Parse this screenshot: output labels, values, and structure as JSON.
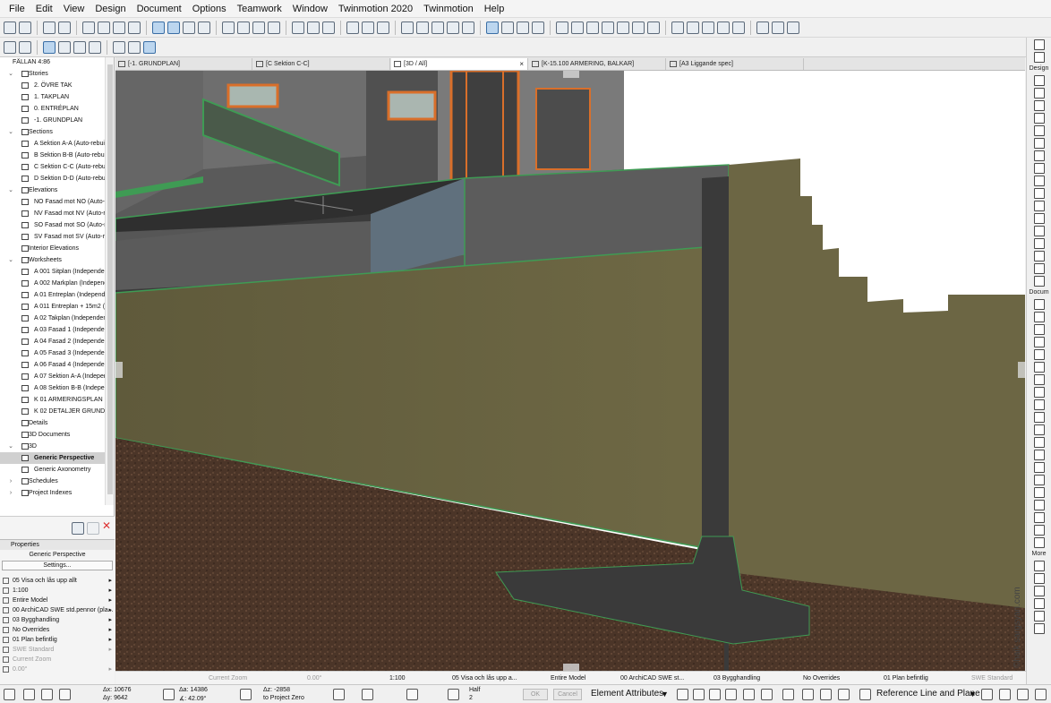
{
  "menu": [
    "File",
    "Edit",
    "View",
    "Design",
    "Document",
    "Options",
    "Teamwork",
    "Window",
    "Twinmotion 2020",
    "Twinmotion",
    "Help"
  ],
  "navigator": {
    "project": "FÄLLAN 4:86",
    "tree": [
      {
        "label": "Stories",
        "level": 1,
        "expander": "open",
        "icon": "stories-icon"
      },
      {
        "label": "2. ÖVRE TAK",
        "level": 2,
        "icon": "story-icon"
      },
      {
        "label": "1. TAKPLAN",
        "level": 2,
        "icon": "story-icon"
      },
      {
        "label": "0. ENTRÉPLAN",
        "level": 2,
        "icon": "story-icon"
      },
      {
        "label": "-1. GRUNDPLAN",
        "level": 2,
        "icon": "story-icon"
      },
      {
        "label": "Sections",
        "level": 1,
        "expander": "open",
        "icon": "sections-icon"
      },
      {
        "label": "A Sektion A-A (Auto-rebuil",
        "level": 2,
        "icon": "section-icon"
      },
      {
        "label": "B Sektion B-B (Auto-rebuil",
        "level": 2,
        "icon": "section-icon"
      },
      {
        "label": "C Sektion C-C (Auto-rebuil",
        "level": 2,
        "icon": "section-icon"
      },
      {
        "label": "D Sektion D-D (Auto-rebuil",
        "level": 2,
        "icon": "section-icon"
      },
      {
        "label": "Elevations",
        "level": 1,
        "expander": "open",
        "icon": "elevations-icon"
      },
      {
        "label": "NO Fasad mot NO (Auto-re",
        "level": 2,
        "icon": "elevation-icon"
      },
      {
        "label": "NV Fasad mot NV (Auto-re",
        "level": 2,
        "icon": "elevation-icon"
      },
      {
        "label": "SO Fasad mot SO (Auto-re",
        "level": 2,
        "icon": "elevation-icon"
      },
      {
        "label": "SV Fasad mot SV (Auto-rel",
        "level": 2,
        "icon": "elevation-icon"
      },
      {
        "label": "Interior Elevations",
        "level": 1,
        "icon": "interior-elevations-icon"
      },
      {
        "label": "Worksheets",
        "level": 1,
        "expander": "open",
        "icon": "worksheets-icon"
      },
      {
        "label": "A 001 Sitplan (Independen",
        "level": 2,
        "icon": "worksheet-icon"
      },
      {
        "label": "A 002 Markplan (Independ",
        "level": 2,
        "icon": "worksheet-icon"
      },
      {
        "label": "A 01 Entreplan (Independ",
        "level": 2,
        "icon": "worksheet-icon"
      },
      {
        "label": "A 011 Entreplan + 15m2 (I",
        "level": 2,
        "icon": "worksheet-icon"
      },
      {
        "label": "A 02 Takplan (Independen",
        "level": 2,
        "icon": "worksheet-icon"
      },
      {
        "label": "A 03 Fasad 1 (Independen",
        "level": 2,
        "icon": "worksheet-icon"
      },
      {
        "label": "A 04 Fasad 2 (Independen",
        "level": 2,
        "icon": "worksheet-icon"
      },
      {
        "label": "A 05 Fasad 3 (Independen",
        "level": 2,
        "icon": "worksheet-icon"
      },
      {
        "label": "A 06 Fasad 4 (Independen",
        "level": 2,
        "icon": "worksheet-icon"
      },
      {
        "label": "A 07 Sektion A-A (Indepen",
        "level": 2,
        "icon": "worksheet-icon"
      },
      {
        "label": "A 08 Sektion B-B (Independ",
        "level": 2,
        "icon": "worksheet-icon"
      },
      {
        "label": "K 01 ARMERINGSPLAN (Inc",
        "level": 2,
        "icon": "worksheet-icon"
      },
      {
        "label": "K 02 DETALJER GRUND (In",
        "level": 2,
        "icon": "worksheet-icon"
      },
      {
        "label": "Details",
        "level": 1,
        "icon": "details-icon"
      },
      {
        "label": "3D Documents",
        "level": 1,
        "icon": "3d-documents-icon"
      },
      {
        "label": "3D",
        "level": 1,
        "expander": "open",
        "icon": "3d-icon"
      },
      {
        "label": "Generic Perspective",
        "level": 2,
        "icon": "perspective-icon",
        "selected": true
      },
      {
        "label": "Generic Axonometry",
        "level": 2,
        "icon": "axonometry-icon"
      },
      {
        "label": "Schedules",
        "level": 1,
        "expander": "closed",
        "icon": "schedules-icon"
      },
      {
        "label": "Project Indexes",
        "level": 1,
        "expander": "closed",
        "icon": "project-indexes-icon"
      }
    ]
  },
  "properties": {
    "header": "Properties",
    "view_name": "Generic Perspective",
    "settings_label": "Settings...",
    "rows": [
      {
        "text": "05 Visa och lås upp allt",
        "arrow": true,
        "dim": false,
        "icon": "layers-icon"
      },
      {
        "text": "1:100",
        "arrow": true,
        "dim": false,
        "icon": "scale-icon"
      },
      {
        "text": "Entire Model",
        "arrow": true,
        "dim": false,
        "icon": "structure-icon"
      },
      {
        "text": "00 ArchiCAD SWE std.pennor (pla...",
        "arrow": true,
        "dim": false,
        "icon": "pen-set-icon"
      },
      {
        "text": "03 Bygghandling",
        "arrow": true,
        "dim": false,
        "icon": "model-view-icon"
      },
      {
        "text": "No Overrides",
        "arrow": true,
        "dim": false,
        "icon": "override-icon"
      },
      {
        "text": "01 Plan befintlig",
        "arrow": true,
        "dim": false,
        "icon": "renovation-icon"
      },
      {
        "text": "SWE Standard",
        "arrow": true,
        "dim": true,
        "icon": "dimension-icon"
      },
      {
        "text": "Current Zoom",
        "arrow": false,
        "dim": true,
        "icon": "zoom-icon"
      },
      {
        "text": "0.00°",
        "arrow": true,
        "dim": true,
        "icon": "rotation-icon"
      }
    ]
  },
  "tabs": [
    {
      "label": "[-1. GRUNDPLAN]",
      "active": false,
      "close": false
    },
    {
      "label": "[C Sektion C-C]",
      "active": false,
      "close": false
    },
    {
      "label": "[3D / All]",
      "active": true,
      "close": true
    },
    {
      "label": "[K-15.100 ARMERING, BALKAR]",
      "active": false,
      "close": false
    },
    {
      "label": "[A3 Liggande spec]",
      "active": false,
      "close": false
    }
  ],
  "toolbox": {
    "sections": [
      "Design",
      "Docum",
      "More"
    ]
  },
  "viewport_status": {
    "zoom": "Current Zoom",
    "angle": "0.00°",
    "scale": "1:100",
    "layer": "05 Visa och lås upp a...",
    "structure": "Entire Model",
    "pens": "00 ArchiCAD SWE st...",
    "model_view": "03 Bygghandling",
    "overrides": "No Overrides",
    "renovation": "01 Plan befintlig",
    "dimension": "SWE Standard"
  },
  "infobar": {
    "dx": "Δx: 10676",
    "dy": "Δy: 9642",
    "da": "Δa: 14386",
    "angle": "∡: 42.09°",
    "dz": "Δz: -2858",
    "to_project_zero": "to Project Zero",
    "half": "Half",
    "half_value": "2",
    "ok": "OK",
    "cancel": "Cancel",
    "element_attributes": "Element Attributes",
    "reference_line": "Reference Line and Plane"
  },
  "watermark": "©haik sargsyan.com",
  "colors": {
    "wall_fill": "#6b6441",
    "concrete": "#3b3b3b",
    "soil": "#4b3528",
    "accent_orange": "#d96f2a",
    "edge_green": "#3f9b54"
  }
}
